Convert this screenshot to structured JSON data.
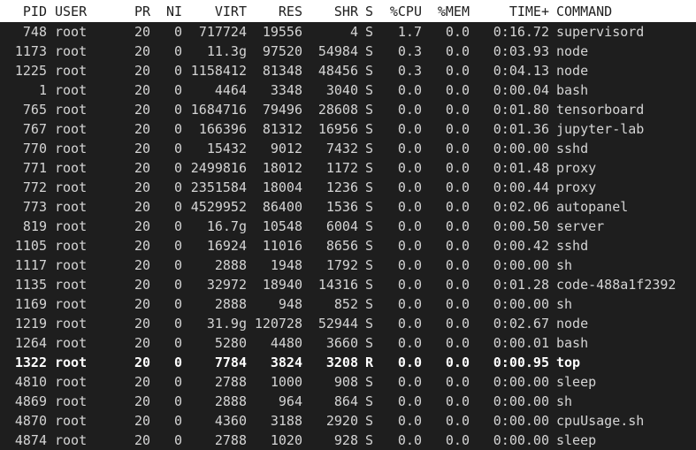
{
  "header": {
    "pid": "PID",
    "user": "USER",
    "pr": "PR",
    "ni": "NI",
    "virt": "VIRT",
    "res": "RES",
    "shr": "SHR",
    "s": "S",
    "cpu": "%CPU",
    "mem": "%MEM",
    "time": "TIME+",
    "command": "COMMAND"
  },
  "processes": [
    {
      "pid": "748",
      "user": "root",
      "pr": "20",
      "ni": "0",
      "virt": "717724",
      "res": "19556",
      "shr": "4",
      "s": "S",
      "cpu": "1.7",
      "mem": "0.0",
      "time": "0:16.72",
      "command": "supervisord"
    },
    {
      "pid": "1173",
      "user": "root",
      "pr": "20",
      "ni": "0",
      "virt": "11.3g",
      "res": "97520",
      "shr": "54984",
      "s": "S",
      "cpu": "0.3",
      "mem": "0.0",
      "time": "0:03.93",
      "command": "node"
    },
    {
      "pid": "1225",
      "user": "root",
      "pr": "20",
      "ni": "0",
      "virt": "1158412",
      "res": "81348",
      "shr": "48456",
      "s": "S",
      "cpu": "0.3",
      "mem": "0.0",
      "time": "0:04.13",
      "command": "node"
    },
    {
      "pid": "1",
      "user": "root",
      "pr": "20",
      "ni": "0",
      "virt": "4464",
      "res": "3348",
      "shr": "3040",
      "s": "S",
      "cpu": "0.0",
      "mem": "0.0",
      "time": "0:00.04",
      "command": "bash"
    },
    {
      "pid": "765",
      "user": "root",
      "pr": "20",
      "ni": "0",
      "virt": "1684716",
      "res": "79496",
      "shr": "28608",
      "s": "S",
      "cpu": "0.0",
      "mem": "0.0",
      "time": "0:01.80",
      "command": "tensorboard"
    },
    {
      "pid": "767",
      "user": "root",
      "pr": "20",
      "ni": "0",
      "virt": "166396",
      "res": "81312",
      "shr": "16956",
      "s": "S",
      "cpu": "0.0",
      "mem": "0.0",
      "time": "0:01.36",
      "command": "jupyter-lab"
    },
    {
      "pid": "770",
      "user": "root",
      "pr": "20",
      "ni": "0",
      "virt": "15432",
      "res": "9012",
      "shr": "7432",
      "s": "S",
      "cpu": "0.0",
      "mem": "0.0",
      "time": "0:00.00",
      "command": "sshd"
    },
    {
      "pid": "771",
      "user": "root",
      "pr": "20",
      "ni": "0",
      "virt": "2499816",
      "res": "18012",
      "shr": "1172",
      "s": "S",
      "cpu": "0.0",
      "mem": "0.0",
      "time": "0:01.48",
      "command": "proxy"
    },
    {
      "pid": "772",
      "user": "root",
      "pr": "20",
      "ni": "0",
      "virt": "2351584",
      "res": "18004",
      "shr": "1236",
      "s": "S",
      "cpu": "0.0",
      "mem": "0.0",
      "time": "0:00.44",
      "command": "proxy"
    },
    {
      "pid": "773",
      "user": "root",
      "pr": "20",
      "ni": "0",
      "virt": "4529952",
      "res": "86400",
      "shr": "1536",
      "s": "S",
      "cpu": "0.0",
      "mem": "0.0",
      "time": "0:02.06",
      "command": "autopanel"
    },
    {
      "pid": "819",
      "user": "root",
      "pr": "20",
      "ni": "0",
      "virt": "16.7g",
      "res": "10548",
      "shr": "6004",
      "s": "S",
      "cpu": "0.0",
      "mem": "0.0",
      "time": "0:00.50",
      "command": "server"
    },
    {
      "pid": "1105",
      "user": "root",
      "pr": "20",
      "ni": "0",
      "virt": "16924",
      "res": "11016",
      "shr": "8656",
      "s": "S",
      "cpu": "0.0",
      "mem": "0.0",
      "time": "0:00.42",
      "command": "sshd"
    },
    {
      "pid": "1117",
      "user": "root",
      "pr": "20",
      "ni": "0",
      "virt": "2888",
      "res": "1948",
      "shr": "1792",
      "s": "S",
      "cpu": "0.0",
      "mem": "0.0",
      "time": "0:00.00",
      "command": "sh"
    },
    {
      "pid": "1135",
      "user": "root",
      "pr": "20",
      "ni": "0",
      "virt": "32972",
      "res": "18940",
      "shr": "14316",
      "s": "S",
      "cpu": "0.0",
      "mem": "0.0",
      "time": "0:01.28",
      "command": "code-488a1f2392"
    },
    {
      "pid": "1169",
      "user": "root",
      "pr": "20",
      "ni": "0",
      "virt": "2888",
      "res": "948",
      "shr": "852",
      "s": "S",
      "cpu": "0.0",
      "mem": "0.0",
      "time": "0:00.00",
      "command": "sh"
    },
    {
      "pid": "1219",
      "user": "root",
      "pr": "20",
      "ni": "0",
      "virt": "31.9g",
      "res": "120728",
      "shr": "52944",
      "s": "S",
      "cpu": "0.0",
      "mem": "0.0",
      "time": "0:02.67",
      "command": "node"
    },
    {
      "pid": "1264",
      "user": "root",
      "pr": "20",
      "ni": "0",
      "virt": "5280",
      "res": "4480",
      "shr": "3660",
      "s": "S",
      "cpu": "0.0",
      "mem": "0.0",
      "time": "0:00.01",
      "command": "bash"
    },
    {
      "pid": "1322",
      "user": "root",
      "pr": "20",
      "ni": "0",
      "virt": "7784",
      "res": "3824",
      "shr": "3208",
      "s": "R",
      "cpu": "0.0",
      "mem": "0.0",
      "time": "0:00.95",
      "command": "top",
      "highlight": true
    },
    {
      "pid": "4810",
      "user": "root",
      "pr": "20",
      "ni": "0",
      "virt": "2788",
      "res": "1000",
      "shr": "908",
      "s": "S",
      "cpu": "0.0",
      "mem": "0.0",
      "time": "0:00.00",
      "command": "sleep"
    },
    {
      "pid": "4869",
      "user": "root",
      "pr": "20",
      "ni": "0",
      "virt": "2888",
      "res": "964",
      "shr": "864",
      "s": "S",
      "cpu": "0.0",
      "mem": "0.0",
      "time": "0:00.00",
      "command": "sh"
    },
    {
      "pid": "4870",
      "user": "root",
      "pr": "20",
      "ni": "0",
      "virt": "4360",
      "res": "3188",
      "shr": "2920",
      "s": "S",
      "cpu": "0.0",
      "mem": "0.0",
      "time": "0:00.00",
      "command": "cpuUsage.sh"
    },
    {
      "pid": "4874",
      "user": "root",
      "pr": "20",
      "ni": "0",
      "virt": "2788",
      "res": "1020",
      "shr": "928",
      "s": "S",
      "cpu": "0.0",
      "mem": "0.0",
      "time": "0:00.00",
      "command": "sleep"
    }
  ]
}
